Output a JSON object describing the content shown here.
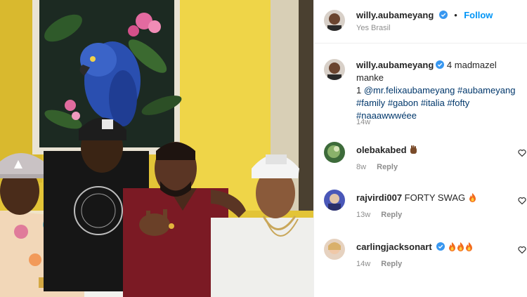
{
  "post": {
    "author": "willy.aubameyang",
    "location": "Yes Brasil",
    "follow_label": "Follow",
    "separator": "•",
    "caption": {
      "author": "willy.aubameyang",
      "line1": "4 madmazel manke",
      "line2_prefix": "1",
      "mention": "@mr.felixaubameyang",
      "hashtag1": "#aubameyang",
      "hashtag2": "#family",
      "hashtag3": "#gabon",
      "hashtag4": "#italia",
      "hashtag5": "#fofty",
      "hashtag6": "#naaawwwéee",
      "time": "14w"
    }
  },
  "comments": [
    {
      "username": "olebakabed",
      "text": "",
      "time": "8w",
      "reply_label": "Reply",
      "emoji": "brown-raised-hand"
    },
    {
      "username": "rajvirdi007",
      "text": "FORTY SWAG",
      "time": "13w",
      "reply_label": "Reply",
      "emoji": "fire"
    },
    {
      "username": "carlingjacksonart",
      "text": "",
      "time": "14w",
      "reply_label": "Reply",
      "emoji": "fire-fire-fire"
    }
  ],
  "colors": {
    "link_blue": "#0095f6",
    "hashtag_blue": "#00376b",
    "muted_gray": "#8e8e8e",
    "wall_yellow": "#e6c93a"
  },
  "icons": [
    "verified-badge-icon",
    "heart-icon",
    "fire-emoji",
    "raised-hand-emoji"
  ]
}
